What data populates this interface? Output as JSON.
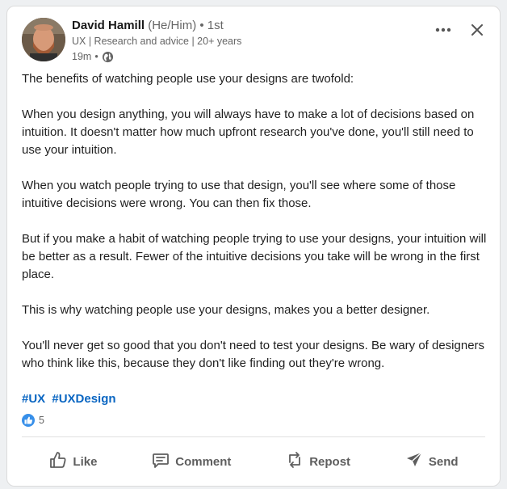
{
  "post": {
    "author": {
      "name": "David Hamill",
      "pronouns": "(He/Him)",
      "degree": "• 1st",
      "headline": "UX | Research and advice | 20+ years",
      "time": "19m",
      "time_separator": "•",
      "visibility_icon": "globe-icon"
    },
    "controls": {
      "more_icon": "more-horizontal-icon",
      "close_icon": "close-icon"
    },
    "paragraphs": [
      "The benefits of watching people use your designs are twofold:",
      "When you design anything, you will always have to make a lot of decisions based on intuition. It doesn't matter how much upfront research you've done, you'll still need to use your intuition.",
      "When you watch people trying to use that design, you'll see where some of those intuitive decisions were wrong. You can then fix those.",
      "But if you make a habit of watching people trying to use your designs, your intuition will be better as a result. Fewer of the intuitive decisions you take will be wrong in the first place.",
      "This is why watching people use your designs, makes you a better designer.",
      "You'll never get so good that you don't need to test your designs. Be wary of designers who think like this, because they don't like finding out they're wrong."
    ],
    "hashtags": [
      "#UX",
      "#UXDesign"
    ],
    "reactions": {
      "icon": "thumbs-up-icon",
      "count": "5"
    },
    "actions": [
      {
        "label": "Like",
        "icon": "like-icon"
      },
      {
        "label": "Comment",
        "icon": "comment-icon"
      },
      {
        "label": "Repost",
        "icon": "repost-icon"
      },
      {
        "label": "Send",
        "icon": "send-icon"
      }
    ]
  },
  "colors": {
    "link": "#0a66c2",
    "reaction_blue": "#378fe9",
    "muted_text": "#666666"
  }
}
